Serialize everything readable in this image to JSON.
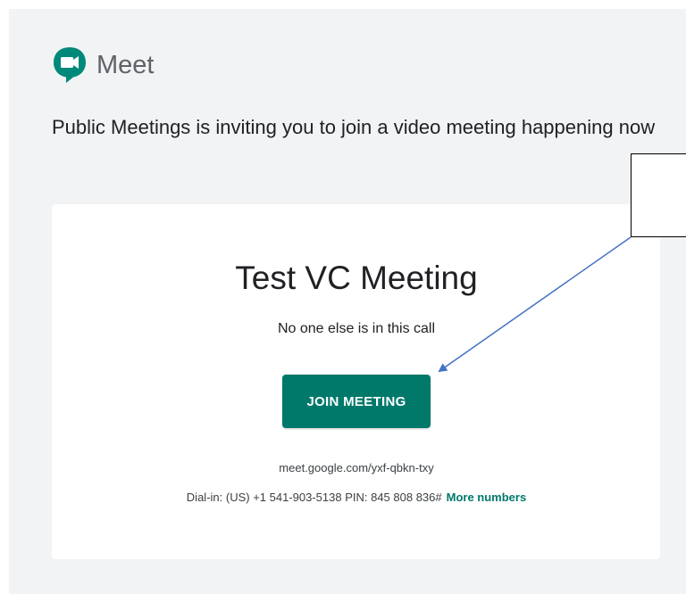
{
  "brand": {
    "icon": "google-meet-icon",
    "name": "Meet",
    "colors": {
      "green": "#00832d",
      "teal": "#00796b"
    }
  },
  "invite": {
    "text": "Public Meetings is inviting you to join a video meeting happening now"
  },
  "card": {
    "meeting_title": "Test VC Meeting",
    "status": "No one else is in this call",
    "join_label": "JOIN MEETING",
    "meeting_link": "meet.google.com/yxf-qbkn-txy",
    "dialin_text": "Dial-in: (US) +1 541-903-5138 PIN: 845 808 836#",
    "more_numbers_label": "More numbers"
  },
  "colors": {
    "background": "#f1f3f4",
    "card": "#ffffff",
    "button": "#00796b",
    "arrow": "#4472c4"
  }
}
